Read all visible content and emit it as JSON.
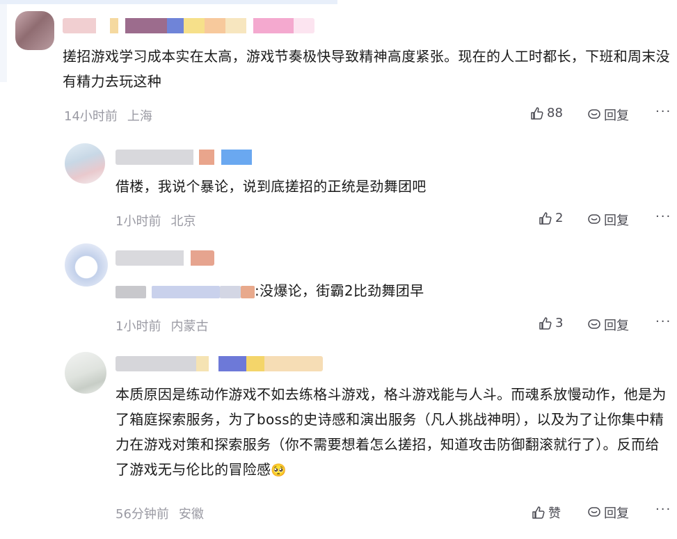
{
  "comments": [
    {
      "text": "搓招游戏学习成本实在太高，游戏节奏极快导致精神高度紧张。现在的人工时都长，下班和周末没有精力去玩这种",
      "time": "14小时前",
      "location": "上海",
      "likes": "88",
      "reply_label": "回复",
      "more": "···"
    },
    {
      "text": "借楼，我说个暴论，说到底搓招的正统是劲舞团吧",
      "time": "1小时前",
      "location": "北京",
      "likes": "2",
      "reply_label": "回复",
      "more": "···"
    },
    {
      "text": ":没爆论，街霸2比劲舞团早",
      "time": "1小时前",
      "location": "内蒙古",
      "likes": "3",
      "reply_label": "回复",
      "more": "···"
    },
    {
      "text": "本质原因是练动作游戏不如去练格斗游戏，格斗游戏能与人斗。而魂系放慢动作，他是为了箱庭探索服务，为了boss的史诗感和演出服务（凡人挑战神明），以及为了让你集中精力在游戏对策和探索服务（你不需要想着怎么搓招，知道攻击防御翻滚就行了）。反而给了游戏无与伦比的冒险感",
      "emoji": "🥺",
      "time": "56分钟前",
      "location": "安徽",
      "likes": "赞",
      "reply_label": "回复",
      "more": "···"
    }
  ],
  "colors": {
    "text": "#1a1a1a",
    "meta": "#9a9aa3",
    "action": "#4a4a52"
  }
}
